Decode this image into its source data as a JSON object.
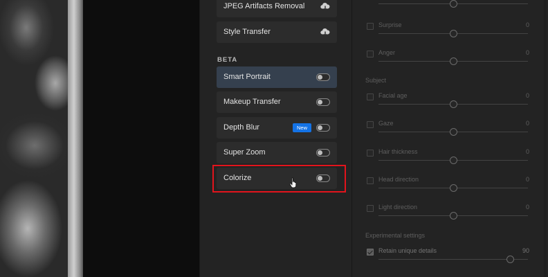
{
  "filters": {
    "items_top": [
      {
        "label": "JPEG Artifacts Removal",
        "icon": "cloud-download-icon"
      },
      {
        "label": "Style Transfer",
        "icon": "cloud-download-icon"
      }
    ],
    "beta_title": "BETA",
    "beta_items": [
      {
        "label": "Smart Portrait",
        "active": true,
        "badge": ""
      },
      {
        "label": "Makeup Transfer",
        "active": false,
        "badge": ""
      },
      {
        "label": "Depth Blur",
        "active": false,
        "badge": "New"
      },
      {
        "label": "Super Zoom",
        "active": false,
        "badge": ""
      },
      {
        "label": "Colorize",
        "active": false,
        "badge": ""
      }
    ]
  },
  "settings": {
    "emotion_rows": [
      {
        "name": "Surprise",
        "value": "0"
      },
      {
        "name": "Anger",
        "value": "0"
      }
    ],
    "subject_title": "Subject",
    "subject_rows": [
      {
        "name": "Facial age",
        "value": "0"
      },
      {
        "name": "Gaze",
        "value": "0"
      },
      {
        "name": "Hair thickness",
        "value": "0"
      },
      {
        "name": "Head direction",
        "value": "0"
      },
      {
        "name": "Light direction",
        "value": "0"
      }
    ],
    "experimental_title": "Experimental settings",
    "retain": {
      "name": "Retain unique details",
      "value": "90",
      "checked": true
    }
  },
  "colors": {
    "highlight": "#e3141c",
    "badge": "#1473e6",
    "active_item": "#35404e"
  }
}
